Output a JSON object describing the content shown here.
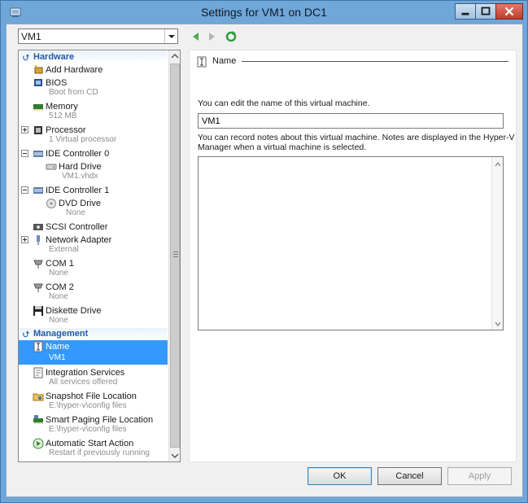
{
  "window": {
    "title": "Settings for VM1 on DC1"
  },
  "toolbar": {
    "vm_selected": "VM1"
  },
  "tree": {
    "hardware_header": "Hardware",
    "management_header": "Management",
    "items": [
      {
        "label": "Add Hardware",
        "sub": ""
      },
      {
        "label": "BIOS",
        "sub": "Boot from CD"
      },
      {
        "label": "Memory",
        "sub": "512 MB"
      },
      {
        "label": "Processor",
        "sub": "1 Virtual processor"
      },
      {
        "label": "IDE Controller 0",
        "sub": ""
      },
      {
        "label": "Hard Drive",
        "sub": "VM1.vhdx"
      },
      {
        "label": "IDE Controller 1",
        "sub": ""
      },
      {
        "label": "DVD Drive",
        "sub": "None"
      },
      {
        "label": "SCSI Controller",
        "sub": ""
      },
      {
        "label": "Network Adapter",
        "sub": "External"
      },
      {
        "label": "COM 1",
        "sub": "None"
      },
      {
        "label": "COM 2",
        "sub": "None"
      },
      {
        "label": "Diskette Drive",
        "sub": "None"
      }
    ],
    "mgmt_items": [
      {
        "label": "Name",
        "sub": "VM1"
      },
      {
        "label": "Integration Services",
        "sub": "All services offered"
      },
      {
        "label": "Snapshot File Location",
        "sub": "E:\\hyper-v\\config files"
      },
      {
        "label": "Smart Paging File Location",
        "sub": "E:\\hyper-v\\config files"
      },
      {
        "label": "Automatic Start Action",
        "sub": "Restart if previously running"
      }
    ]
  },
  "panel": {
    "title": "Name",
    "name_prompt": "You can edit the name of this virtual machine.",
    "name_value": "VM1",
    "notes_prompt_line1": "You can record notes about this virtual machine. Notes are displayed in the Hyper-V",
    "notes_prompt_line2": "Manager when a virtual machine is selected."
  },
  "buttons": {
    "ok": "OK",
    "cancel": "Cancel",
    "apply": "Apply"
  },
  "colors": {
    "selection": "#3399ff",
    "section_header": "#1e5aa8",
    "titlebar": "#6ea7d8"
  }
}
